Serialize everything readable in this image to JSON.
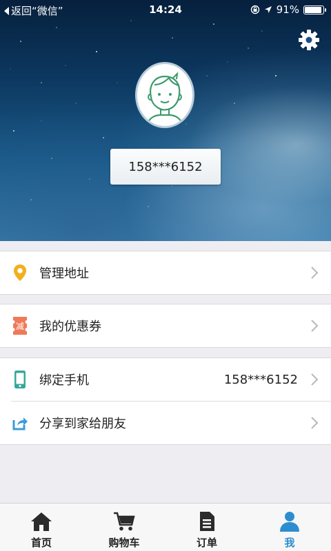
{
  "status_bar": {
    "back_label": "返回“微信”",
    "time": "14:24",
    "battery_percent": "91%",
    "battery_level": 0.91
  },
  "profile": {
    "phone_masked": "158***6152"
  },
  "menu": {
    "address": {
      "label": "管理地址",
      "icon": "location-pin-icon",
      "color": "#f2b01e"
    },
    "coupons": {
      "label": "我的优惠券",
      "icon": "coupon-icon",
      "icon_text": "减",
      "color": "#ef7a5a"
    },
    "bind_phone": {
      "label": "绑定手机",
      "value": "158***6152",
      "icon": "phone-icon",
      "color": "#35a89a"
    },
    "share": {
      "label": "分享到家给朋友",
      "icon": "share-icon",
      "color": "#3d9bd8"
    }
  },
  "tabs": [
    {
      "label": "首页",
      "icon": "home-icon",
      "active": false
    },
    {
      "label": "购物车",
      "icon": "cart-icon",
      "active": false
    },
    {
      "label": "订单",
      "icon": "order-document-icon",
      "active": false
    },
    {
      "label": "我",
      "icon": "user-icon",
      "active": true
    }
  ],
  "colors": {
    "accent": "#2d8ecf",
    "tab_inactive": "#222222"
  }
}
